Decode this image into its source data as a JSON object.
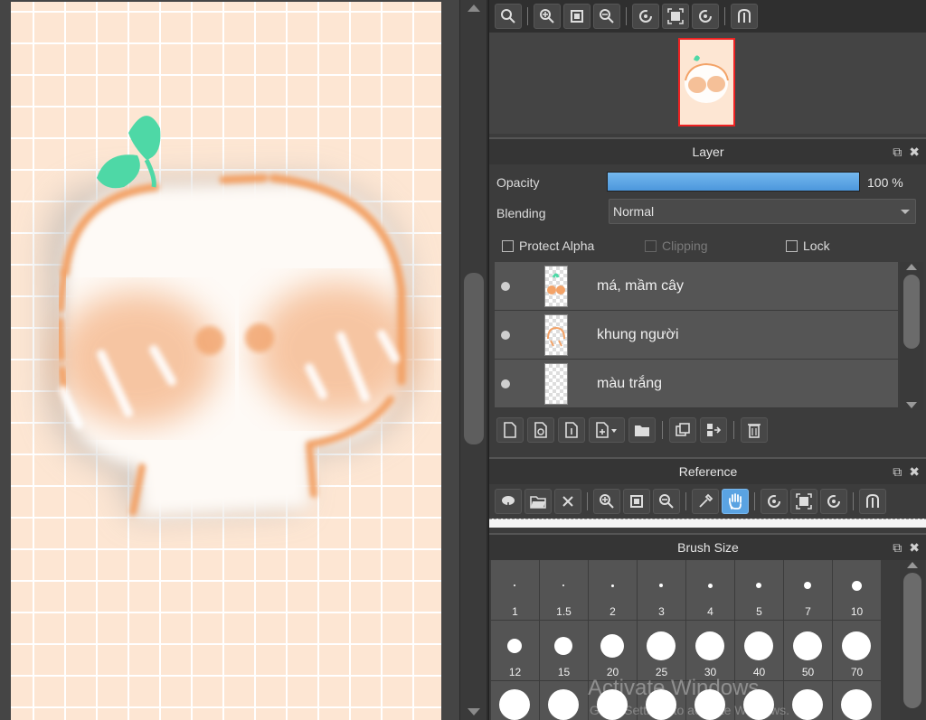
{
  "app": {
    "accent": "#5aa3e2"
  },
  "navigator": {
    "tools": [
      "magnify-icon",
      "zoom-in-icon",
      "fit-icon",
      "zoom-out-icon",
      "rotate-left-icon",
      "fullscreen-icon",
      "rotate-right-icon",
      "flip-icon"
    ]
  },
  "layer_panel": {
    "title": "Layer",
    "opacity_label": "Opacity",
    "opacity_value": "100 %",
    "opacity_fraction": 1.0,
    "blending_label": "Blending",
    "blending_value": "Normal",
    "protect_alpha_label": "Protect Alpha",
    "clipping_label": "Clipping",
    "lock_label": "Lock",
    "layers": [
      {
        "name": "má, mầm cây"
      },
      {
        "name": "khung người"
      },
      {
        "name": "màu trắng"
      }
    ]
  },
  "reference_panel": {
    "title": "Reference"
  },
  "brush_panel": {
    "title": "Brush Size",
    "sizes": [
      "1",
      "1.5",
      "2",
      "3",
      "4",
      "5",
      "7",
      "10",
      "12",
      "15",
      "20",
      "25",
      "30",
      "40",
      "50",
      "70",
      "",
      "",
      "",
      "",
      "",
      "",
      "",
      ""
    ]
  },
  "watermark": {
    "title": "Activate Windows",
    "subtitle": "Go to Settings to activate Windows."
  }
}
